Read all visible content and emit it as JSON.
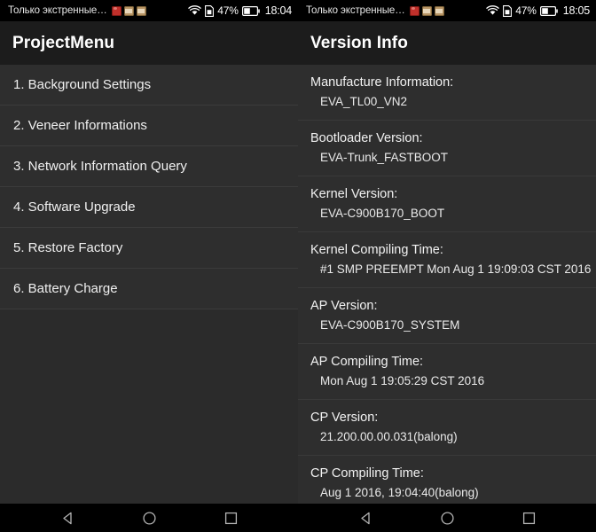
{
  "status_bar": {
    "carrier": "Только экстренные…",
    "notification_icons": [
      "app-red-icon",
      "app-tan-mail-icon",
      "app-tan-image-icon"
    ],
    "wifi_icon": "wifi-icon",
    "sim_icon": "sim-card-icon",
    "battery_percent": "47%",
    "battery_level": 47,
    "battery_icon": "battery-icon",
    "time_left": "18:04",
    "time_right": "18:05"
  },
  "left_panel": {
    "title": "ProjectMenu",
    "items": [
      {
        "label": "1. Background Settings"
      },
      {
        "label": "2. Veneer Informations"
      },
      {
        "label": "3. Network Information Query"
      },
      {
        "label": "4. Software Upgrade"
      },
      {
        "label": "5. Restore Factory"
      },
      {
        "label": "6. Battery Charge"
      }
    ]
  },
  "right_panel": {
    "title": "Version Info",
    "entries": [
      {
        "label": "Manufacture Information:",
        "value": "EVA_TL00_VN2"
      },
      {
        "label": "Bootloader Version:",
        "value": "EVA-Trunk_FASTBOOT"
      },
      {
        "label": "Kernel Version:",
        "value": "EVA-C900B170_BOOT"
      },
      {
        "label": "Kernel Compiling Time:",
        "value": "#1 SMP PREEMPT Mon Aug 1 19:09:03 CST 2016"
      },
      {
        "label": "AP Version:",
        "value": "EVA-C900B170_SYSTEM"
      },
      {
        "label": "AP Compiling Time:",
        "value": "Mon Aug  1 19:05:29 CST 2016"
      },
      {
        "label": "CP Version:",
        "value": "21.200.00.00.031(balong)"
      },
      {
        "label": "CP Compiling Time:",
        "value": "Aug  1 2016, 19:04:40(balong)"
      }
    ]
  },
  "nav_bar": {
    "back": "back-icon",
    "home": "home-icon",
    "recents": "recents-icon"
  },
  "colors": {
    "status_bar_bg": "#000000",
    "header_bg": "#1c1c1c",
    "row_bg": "#2e2e2e",
    "panel_bg": "#2b2b2b",
    "divider": "#3b3b3b",
    "text_primary": "#f2f2f2",
    "nav_bg": "#000000"
  }
}
